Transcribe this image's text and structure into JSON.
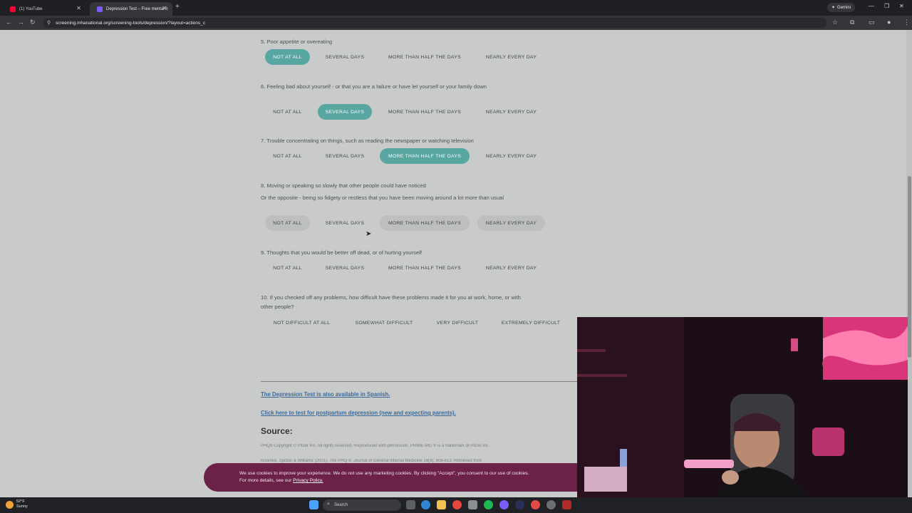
{
  "browser": {
    "tabs": [
      {
        "title": "(1) YouTube",
        "fav_color": "#ff0033"
      },
      {
        "title": "Depression Test – Free mental h",
        "fav_color": "#7c5cff"
      }
    ],
    "gemini_label": "Gemini",
    "url": "screening.mhanational.org/screening-tools/depression/?layout=actions_c"
  },
  "questions": [
    {
      "text": "5. Poor appetite or overeating",
      "options": [
        "NOT AT ALL",
        "SEVERAL DAYS",
        "MORE THAN HALF THE DAYS",
        "NEARLY EVERY DAY"
      ],
      "selected": 0
    },
    {
      "text": "6. Feeling bad about yourself - or that you are a failure or have let yourself or your family down",
      "options": [
        "NOT AT ALL",
        "SEVERAL DAYS",
        "MORE THAN HALF THE DAYS",
        "NEARLY EVERY DAY"
      ],
      "selected": 1
    },
    {
      "text": "7. Trouble concentrating on things, such as reading the newspaper or watching television",
      "options": [
        "NOT AT ALL",
        "SEVERAL DAYS",
        "MORE THAN HALF THE DAYS",
        "NEARLY EVERY DAY"
      ],
      "selected": 2
    },
    {
      "text": "8. Moving or speaking so slowly that other people could have noticed",
      "text2": "Or the opposite - being so fidgety or restless that you have been moving around a lot more than usual",
      "options": [
        "NOT AT ALL",
        "SEVERAL DAYS",
        "MORE THAN HALF THE DAYS",
        "NEARLY EVERY DAY"
      ],
      "selected": null
    },
    {
      "text": "9. Thoughts that you would be better off dead, or of hurting yourself",
      "options": [
        "NOT AT ALL",
        "SEVERAL DAYS",
        "MORE THAN HALF THE DAYS",
        "NEARLY EVERY DAY"
      ],
      "selected": null
    },
    {
      "text": "10. If you checked off any problems, how difficult have these problems made it for you at work, home, or with other people?",
      "options": [
        "NOT DIFFICULT AT ALL",
        "SOMEWHAT DIFFICULT",
        "VERY DIFFICULT",
        "EXTREMELY DIFFICULT"
      ],
      "selected": null
    }
  ],
  "links": {
    "spanish": "The Depression Test is also available in Spanish.",
    "postpartum": "Click here to test for postpartum depression (new and expecting parents)."
  },
  "source": {
    "heading": "Source:",
    "line1": "PHQ9 Copyright © Pfizer Inc. All rights reserved. Reproduced with permission. PRIME-MD ® is a trademark of Pfizer Inc.",
    "line2": "Kroenke, Spitzer & Williams (2001). The PHQ-9. Journal of General Internal Medicine 16(9), 606-613. Retrieved from"
  },
  "cookie": {
    "text": "We use cookies to improve your experience. We do not use any marketing cookies. By clicking \"Accept\", you consent to our use of cookies.",
    "text2": "For more details, see our",
    "policy_link": "Privacy Policy."
  },
  "taskbar": {
    "temp": "52°F",
    "condition": "Sunny",
    "search_placeholder": "Search"
  },
  "colors": {
    "selected_option": "#58a6a0",
    "cookie_bg": "#6b2148",
    "link": "#3b6a99"
  }
}
